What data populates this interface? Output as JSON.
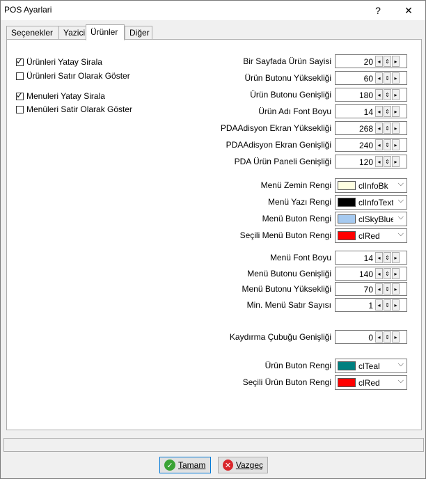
{
  "window": {
    "title": "POS Ayarlari",
    "help_label": "?",
    "close_label": "✕"
  },
  "tabs": [
    {
      "label": "Seçenekler"
    },
    {
      "label": "Yazici"
    },
    {
      "label": "Ürünler",
      "active": true
    },
    {
      "label": "Diğer"
    }
  ],
  "checkboxes": [
    {
      "label": "Ürünleri Yatay Sirala",
      "checked": true
    },
    {
      "label": "Ürünleri Satır Olarak Göster",
      "checked": false
    },
    {
      "label": "Menuleri Yatay Sirala",
      "checked": true
    },
    {
      "label": "Menüleri Satir Olarak Göster",
      "checked": false
    }
  ],
  "spin_fields": [
    {
      "label": "Bir Sayfada Ürün Sayisi",
      "value": "20"
    },
    {
      "label": "Ürün Butonu Yüksekliği",
      "value": "60"
    },
    {
      "label": "Ürün Butonu Genişliği",
      "value": "180"
    },
    {
      "label": "Ürün Adı Font Boyu",
      "value": "14"
    },
    {
      "label": "PDAAdisyon Ekran Yüksekliği",
      "value": "268"
    },
    {
      "label": "PDAAdisyon Ekran Genişliği",
      "value": "240"
    },
    {
      "label": "PDA Ürün Paneli Genişliği",
      "value": "120"
    },
    {
      "label": "Menü Font Boyu",
      "value": "14"
    },
    {
      "label": "Menü Butonu Genişliği",
      "value": "140"
    },
    {
      "label": "Menü Butonu Yüksekliği",
      "value": "70"
    },
    {
      "label": "Min. Menü Satır Sayısı",
      "value": "1"
    },
    {
      "label": "Kaydırma Çubuğu Genişliği",
      "value": "0"
    }
  ],
  "color_fields": [
    {
      "label": "Menü Zemin Rengi",
      "value": "clInfoBk",
      "color": "#ffffe1"
    },
    {
      "label": "Menü Yazı Rengi",
      "value": "clInfoText",
      "color": "#000000"
    },
    {
      "label": "Menü Buton Rengi",
      "value": "clSkyBlue",
      "color": "#a6caf0"
    },
    {
      "label": "Seçili Menü Buton Rengi",
      "value": "clRed",
      "color": "#ff0000"
    },
    {
      "label": "Ürün Buton Rengi",
      "value": "clTeal",
      "color": "#008080"
    },
    {
      "label": "Seçili Ürün Buton Rengi",
      "value": "clRed",
      "color": "#ff0000"
    }
  ],
  "buttons": {
    "ok_label": "Tamam",
    "cancel_label": "Vazgeç"
  },
  "icons": {
    "ok": "check-icon",
    "cancel": "cancel-icon"
  }
}
